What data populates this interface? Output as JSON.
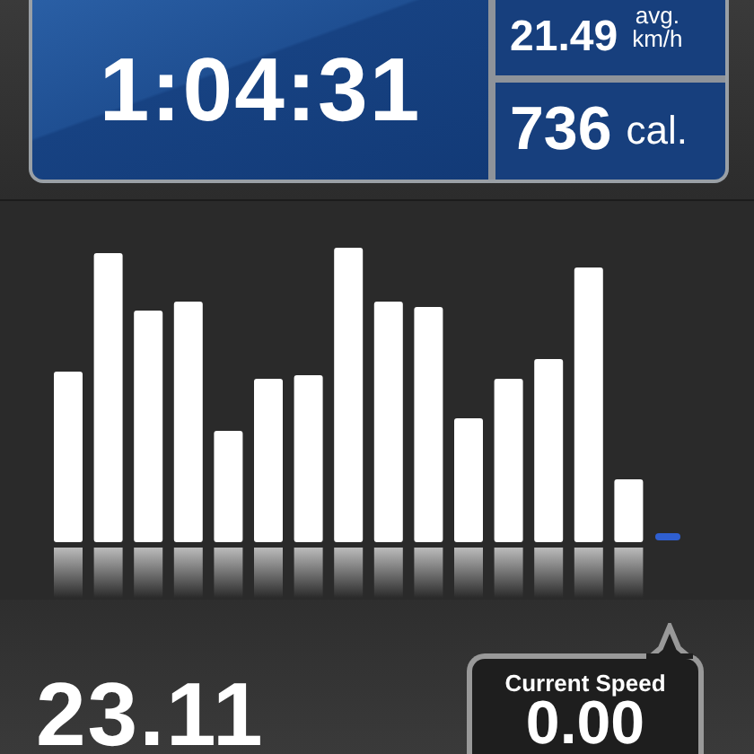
{
  "stats": {
    "duration": "1:04:31",
    "avg_speed": {
      "value": "21.49",
      "label": "avg.",
      "unit": "km/h"
    },
    "calories": {
      "value": "736",
      "unit": "cal."
    }
  },
  "distance": "23.11",
  "current_speed": {
    "label": "Current Speed",
    "value": "0.00"
  }
}
